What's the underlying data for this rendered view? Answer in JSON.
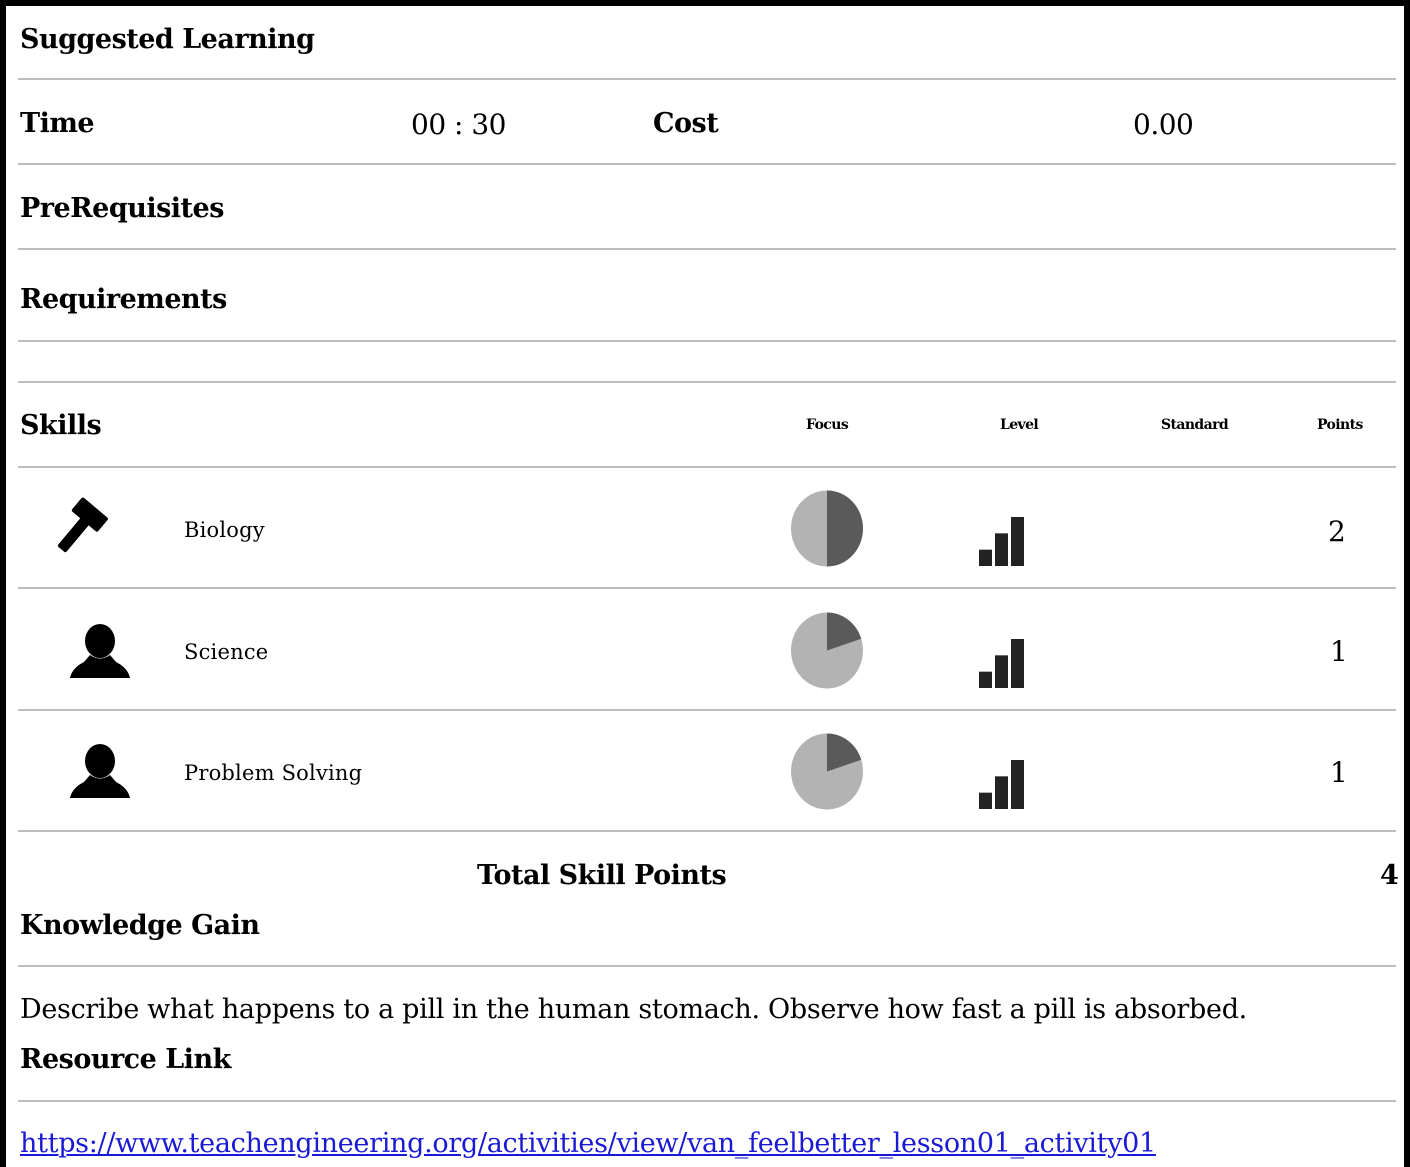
{
  "title": "Suggested Learning",
  "time": {
    "label": "Time",
    "value": "00 : 30"
  },
  "cost": {
    "label": "Cost",
    "value": "0.00"
  },
  "prerequisites_label": "PreRequisites",
  "requirements_label": "Requirements",
  "skills": {
    "label": "Skills",
    "columns": {
      "focus": "Focus",
      "level": "Level",
      "standard": "Standard",
      "points": "Points"
    },
    "rows": [
      {
        "icon": "hammer-icon",
        "name": "Biology",
        "focus_fraction": 0.5,
        "level_bars": 3,
        "points": "2"
      },
      {
        "icon": "person-icon",
        "name": "Science",
        "focus_fraction": 0.2,
        "level_bars": 3,
        "points": "1"
      },
      {
        "icon": "person-icon",
        "name": "Problem Solving",
        "focus_fraction": 0.2,
        "level_bars": 3,
        "points": "1"
      }
    ],
    "total_label": "Total Skill Points",
    "total_value": "4"
  },
  "knowledge_gain": {
    "label": "Knowledge Gain",
    "text": "Describe what happens to a pill in the human stomach. Observe how fast a pill is absorbed."
  },
  "resource_link": {
    "label": "Resource Link",
    "url": "https://www.teachengineering.org/activities/view/van_feelbetter_lesson01_activity01"
  },
  "colors": {
    "pie_dark": "#5a5a5a",
    "pie_light": "#b3b3b3",
    "level_bar": "#222222",
    "rule": "#bdbdbd",
    "link": "#1a1ad6"
  }
}
